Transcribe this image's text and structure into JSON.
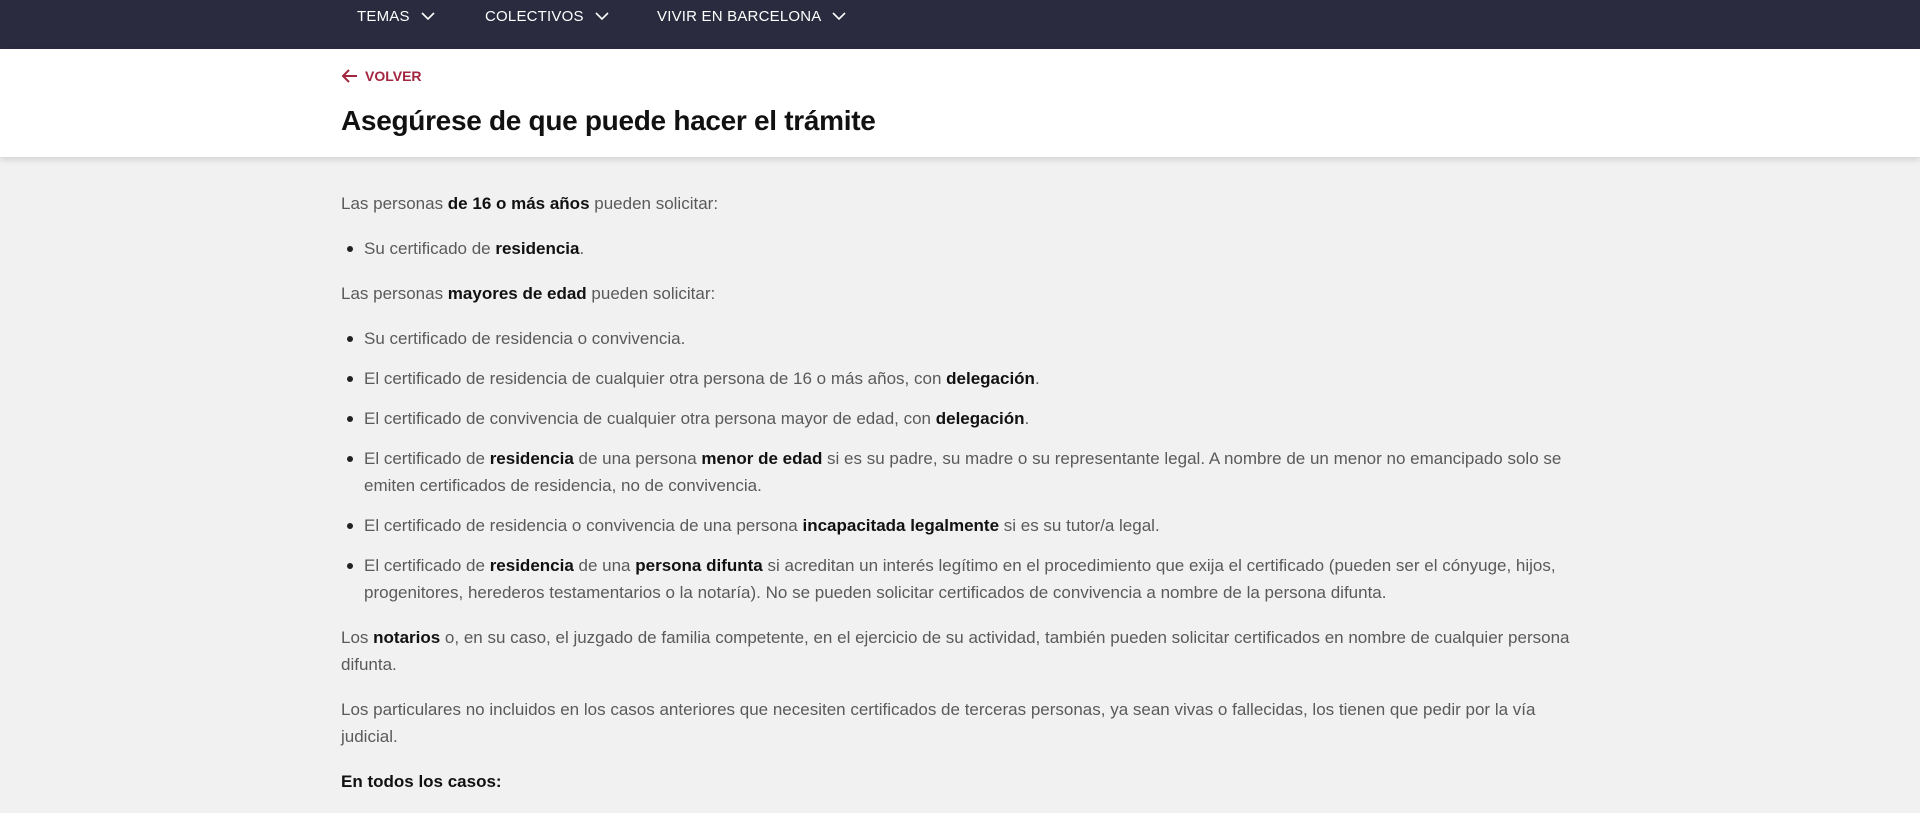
{
  "nav": {
    "items": [
      "TEMAS",
      "COLECTIVOS",
      "VIVIR EN BARCELONA"
    ]
  },
  "header": {
    "back_label": "VOLVER",
    "title": "Asegúrese de que puede hacer el trámite"
  },
  "content": {
    "p1": {
      "a": "Las personas ",
      "b": "de 16 o más años",
      "c": " pueden solicitar:"
    },
    "list1": [
      {
        "a": "Su certificado de ",
        "b": "residencia",
        "c": "."
      }
    ],
    "p2": {
      "a": "Las personas ",
      "b": "mayores de edad",
      "c": " pueden solicitar:"
    },
    "list2": [
      {
        "a": "Su certificado de residencia o convivencia."
      },
      {
        "a": "El certificado de residencia de cualquier otra persona de 16 o más años, con ",
        "b": "delegación",
        "c": "."
      },
      {
        "a": "El certificado de convivencia de cualquier otra persona mayor de edad, con ",
        "b": "delegación",
        "c": "."
      },
      {
        "a": "El certificado de ",
        "b": "residencia",
        "c": " de una persona ",
        "d": "menor de edad",
        "e": " si es su padre, su madre o su representante legal. A nombre de un menor no emancipado solo se emiten certificados de residencia, no de convivencia."
      },
      {
        "a": "El certificado de residencia o convivencia de una persona ",
        "b": "incapacitada legalmente",
        "c": " si es su tutor/a legal."
      },
      {
        "a": "El certificado de ",
        "b": "residencia",
        "c": " de una ",
        "d": "persona difunta",
        "e": " si acreditan un interés legítimo en el procedimiento que exija el certificado (pueden ser el cónyuge, hijos, progenitores, herederos testamentarios o la notaría). No se pueden solicitar certificados de convivencia a nombre de la persona difunta."
      }
    ],
    "p3": {
      "a": "Los ",
      "b": "notarios",
      "c": " o, en su caso, el juzgado de familia competente, en el ejercicio de su actividad, también pueden solicitar certificados en nombre de cualquier persona difunta."
    },
    "p4": "Los particulares no incluidos en los casos anteriores que necesiten certificados de terceras personas, ya sean vivas o fallecidas, los tienen que pedir por la vía judicial.",
    "p5": "En todos los casos:"
  },
  "colors": {
    "nav_bg": "#2a2b3e",
    "accent": "#a3253f",
    "page_bg": "#f1f1f1"
  }
}
